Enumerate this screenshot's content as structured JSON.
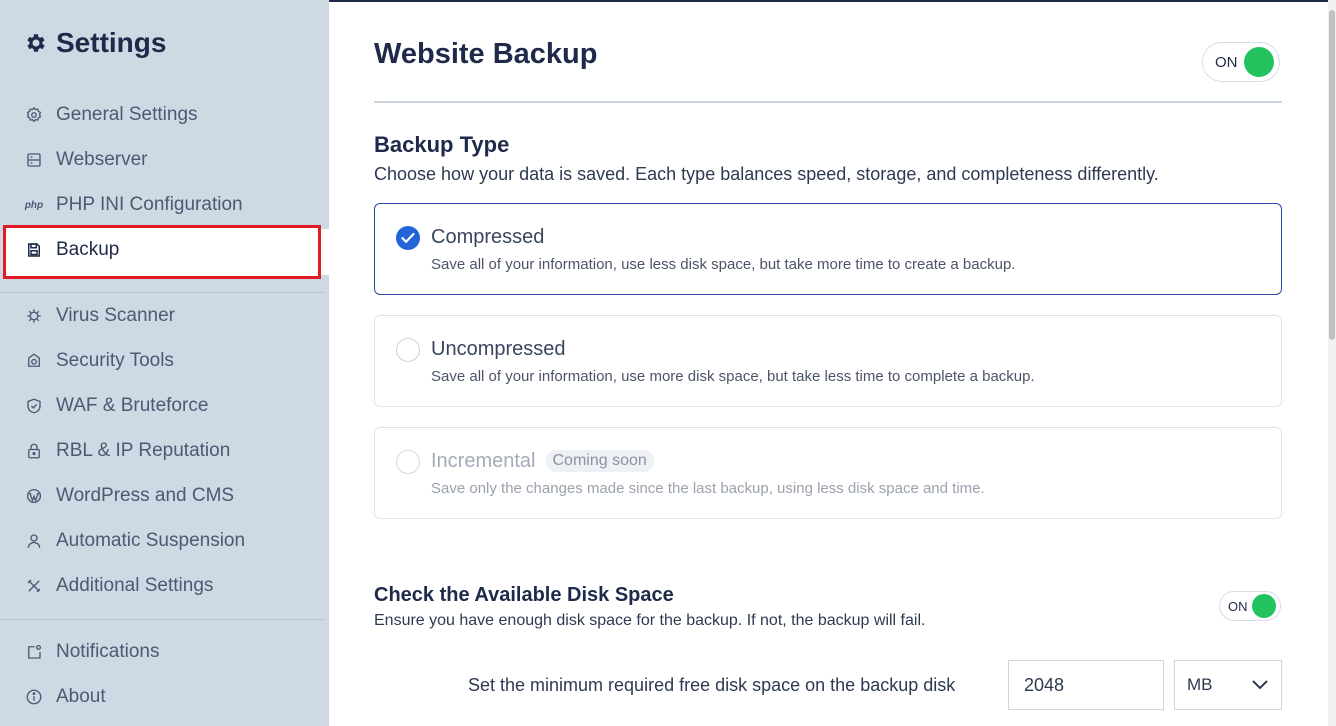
{
  "sidebar": {
    "title": "Settings",
    "items": [
      {
        "label": "General Settings",
        "icon": "gear-outline-icon"
      },
      {
        "label": "Webserver",
        "icon": "server-icon"
      },
      {
        "label": "PHP INI Configuration",
        "icon": "php-icon",
        "icon_text": "php"
      },
      {
        "label": "Backup",
        "icon": "floppy-disk-icon",
        "active": true
      },
      {
        "label": "Virus Scanner",
        "icon": "virus-icon"
      },
      {
        "label": "Security Tools",
        "icon": "security-camera-icon"
      },
      {
        "label": "WAF & Bruteforce",
        "icon": "shield-check-icon"
      },
      {
        "label": "RBL & IP Reputation",
        "icon": "lock-icon"
      },
      {
        "label": "WordPress and CMS",
        "icon": "wordpress-icon"
      },
      {
        "label": "Automatic Suspension",
        "icon": "user-icon"
      },
      {
        "label": "Additional Settings",
        "icon": "tools-icon"
      },
      {
        "label": "Notifications",
        "icon": "notification-icon"
      },
      {
        "label": "About",
        "icon": "info-icon"
      }
    ]
  },
  "main": {
    "title": "Website Backup",
    "main_toggle": "ON",
    "backup_type": {
      "title": "Backup Type",
      "description": "Choose how your data is saved. Each type balances speed, storage, and completeness differently.",
      "options": [
        {
          "title": "Compressed",
          "desc": "Save all of your information, use less disk space, but take more time to create a backup.",
          "selected": true
        },
        {
          "title": "Uncompressed",
          "desc": "Save all of your information, use more disk space, but take less time to complete a backup.",
          "selected": false
        },
        {
          "title": "Incremental",
          "badge": "Coming soon",
          "desc": "Save only the changes made since the last backup, using less disk space and time.",
          "disabled": true
        }
      ]
    },
    "disk_space": {
      "title": "Check the Available Disk Space",
      "description": "Ensure you have enough disk space for the backup. If not, the backup will fail.",
      "toggle": "ON",
      "min_label": "Set the minimum required free disk space on the backup disk",
      "min_value": "2048",
      "unit": "MB"
    }
  },
  "colors": {
    "accent": "#2563d9",
    "toggle_on": "#22c35e",
    "highlight": "#e01b22",
    "sidebar_bg": "#cfd9e4"
  }
}
